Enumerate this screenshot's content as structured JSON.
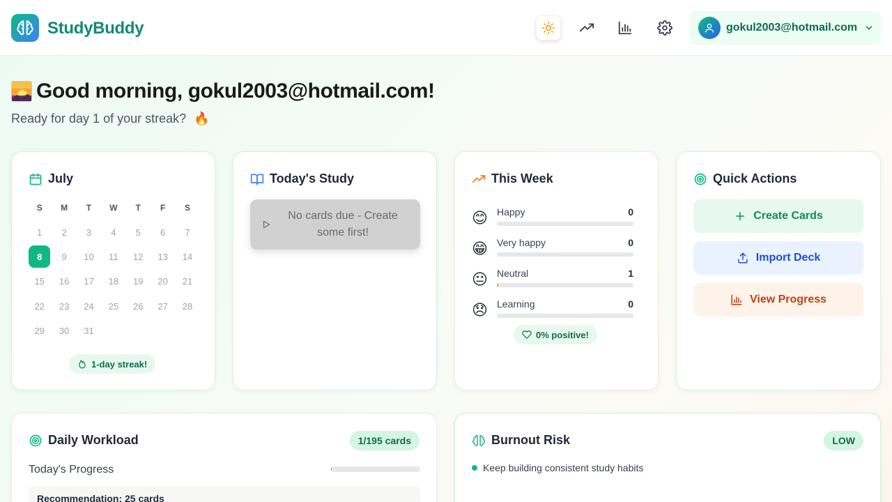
{
  "app": {
    "brand": "StudyBuddy",
    "colors": {
      "primary": "#10b981",
      "accent_blue": "#3b82f6",
      "brand_text": "#138a74"
    }
  },
  "header": {
    "icons": [
      "sun-icon",
      "trending-up-icon",
      "bar-chart-icon",
      "gear-icon"
    ],
    "user_email": "gokul2003@hotmail.com"
  },
  "greeting": {
    "title": "Good morning, gokul2003@hotmail.com!",
    "subtitle": "Ready for day 1 of your streak?",
    "subtitle_emoji": "🔥"
  },
  "calendar": {
    "title": "July",
    "weekdays": [
      "S",
      "M",
      "T",
      "W",
      "T",
      "F",
      "S"
    ],
    "weeks": [
      [
        "1",
        "2",
        "3",
        "4",
        "5",
        "6",
        "7"
      ],
      [
        "8",
        "9",
        "10",
        "11",
        "12",
        "13",
        "14"
      ],
      [
        "15",
        "16",
        "17",
        "18",
        "19",
        "20",
        "21"
      ],
      [
        "22",
        "23",
        "24",
        "25",
        "26",
        "27",
        "28"
      ],
      [
        "29",
        "30",
        "31"
      ]
    ],
    "today": "8",
    "streak_label": "1-day streak!"
  },
  "today_study": {
    "title": "Today's Study",
    "button_label": "No cards due - Create some first!"
  },
  "this_week": {
    "title": "This Week",
    "moods": [
      {
        "emoji": "😊",
        "label": "Happy",
        "count": "0",
        "fraction": 0
      },
      {
        "emoji": "😁",
        "label": "Very happy",
        "count": "0",
        "fraction": 0
      },
      {
        "emoji": "😐",
        "label": "Neutral",
        "count": "1",
        "fraction": 0.01
      },
      {
        "emoji": "😞",
        "label": "Learning",
        "count": "0",
        "fraction": 0
      }
    ],
    "positive_label": "0% positive!"
  },
  "quick_actions": {
    "title": "Quick Actions",
    "create": "Create Cards",
    "import": "Import Deck",
    "progress": "View Progress"
  },
  "daily_workload": {
    "title": "Daily Workload",
    "badge": "1/195 cards",
    "progress_label": "Today's Progress",
    "progress_fraction": 0.0051,
    "recommendation": "Recommendation: 25 cards"
  },
  "burnout": {
    "title": "Burnout Risk",
    "badge": "LOW",
    "tip": "Keep building consistent study habits"
  }
}
